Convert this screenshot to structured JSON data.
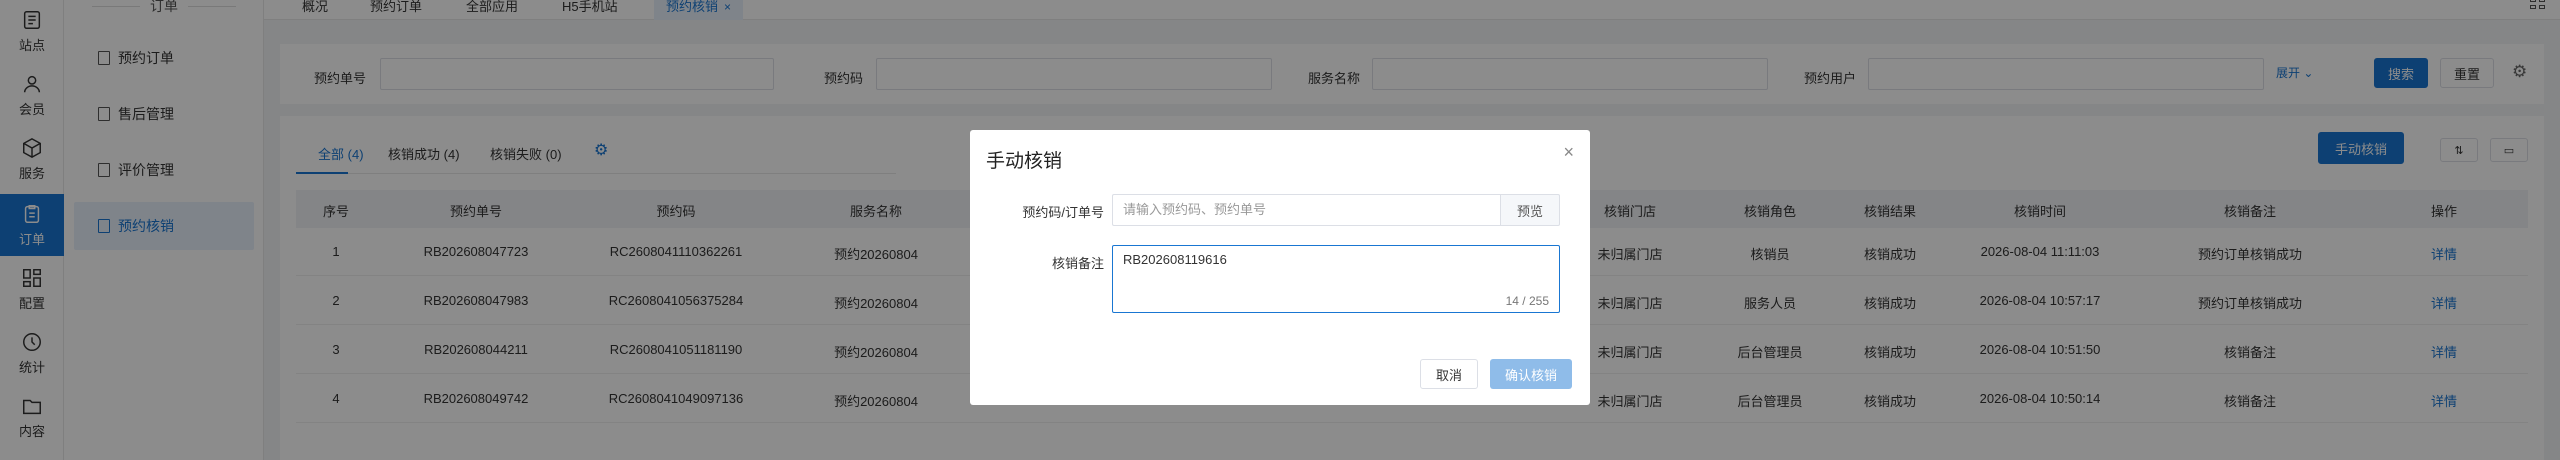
{
  "rail": [
    {
      "label": "站点",
      "icon": "site-icon"
    },
    {
      "label": "会员",
      "icon": "user-icon"
    },
    {
      "label": "服务",
      "icon": "box-icon"
    },
    {
      "label": "订单",
      "icon": "order-icon",
      "active": true
    },
    {
      "label": "配置",
      "icon": "config-icon"
    },
    {
      "label": "统计",
      "icon": "stats-icon"
    },
    {
      "label": "内容",
      "icon": "content-icon"
    }
  ],
  "submenu": {
    "title": "订单",
    "items": [
      "预约订单",
      "售后管理",
      "评价管理",
      "预约核销"
    ]
  },
  "tabs": [
    "概况",
    "预约订单",
    "全部应用",
    "H5手机站",
    "预约核销"
  ],
  "search": {
    "labels": [
      "预约单号",
      "预约码",
      "服务名称",
      "预约用户"
    ],
    "expand": "展开",
    "search_button": "搜索",
    "reset_button": "重置"
  },
  "list": {
    "tabs": [
      {
        "label": "全部",
        "count": "(4)"
      },
      {
        "label": "核销成功",
        "count": "(4)"
      },
      {
        "label": "核销失败",
        "count": "(0)"
      }
    ],
    "manual_button": "手动核销",
    "columns": [
      "序号",
      "预约单号",
      "预约码",
      "服务名称",
      "核销门店",
      "核销角色",
      "核销结果",
      "核销时间",
      "核销备注",
      "操作"
    ],
    "rows": [
      {
        "no": "1",
        "order": "RB202608047723",
        "code": "RC2608041110362261",
        "service": "预约20260804",
        "store": "未归属门店",
        "role": "核销员",
        "result": "核销成功",
        "time": "2026-08-04 11:11:03",
        "remark": "预约订单核销成功",
        "action": "详情"
      },
      {
        "no": "2",
        "order": "RB202608047983",
        "code": "RC2608041056375284",
        "service": "预约20260804",
        "store": "未归属门店",
        "role": "服务人员",
        "result": "核销成功",
        "time": "2026-08-04 10:57:17",
        "remark": "预约订单核销成功",
        "action": "详情"
      },
      {
        "no": "3",
        "order": "RB202608044211",
        "code": "RC2608041051181190",
        "service": "预约20260804",
        "store": "未归属门店",
        "role": "后台管理员",
        "result": "核销成功",
        "time": "2026-08-04 10:51:50",
        "remark": "核销备注",
        "action": "详情"
      },
      {
        "no": "4",
        "order": "RB202608049742",
        "code": "RC2608041049097136",
        "service": "预约20260804",
        "store": "未归属门店",
        "role": "后台管理员",
        "result": "核销成功",
        "time": "2026-08-04 10:50:14",
        "remark": "核销备注",
        "action": "详情"
      }
    ]
  },
  "dialog": {
    "title": "手动核销",
    "code_label": "预约码/订单号",
    "code_placeholder": "请输入预约码、预约单号",
    "preview_button": "预览",
    "remark_label": "核销备注",
    "remark_value": "RB202608119616",
    "counter": "14 / 255",
    "cancel_button": "取消",
    "confirm_button": "确认核销"
  },
  "colors": {
    "accent": "#1976d2",
    "overlay": "rgba(0,0,0,0.45)"
  }
}
